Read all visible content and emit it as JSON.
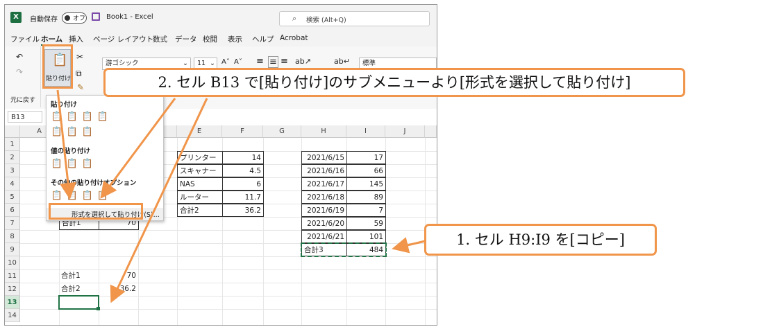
{
  "titlebar": {
    "autosave_label": "自動保存",
    "autosave_state": "オフ",
    "workbook_title": "Book1  -  Excel",
    "search_placeholder": "検索 (Alt+Q)"
  },
  "menu": [
    "ファイル",
    "ホーム",
    "挿入",
    "ページ レイアウト",
    "数式",
    "データ",
    "校閲",
    "表示",
    "ヘルプ",
    "Acrobat"
  ],
  "ribbon": {
    "paste_label": "貼り付け",
    "undo_label": "元に戻す",
    "font_name": "游ゴシック",
    "font_size": "11",
    "number_format": "標準"
  },
  "namebox": "B13",
  "columns": [
    "A",
    "B",
    "C",
    "D",
    "E",
    "F",
    "G",
    "H",
    "I",
    "J"
  ],
  "rows": [
    "1",
    "2",
    "3",
    "4",
    "5",
    "6",
    "7",
    "8",
    "9",
    "10",
    "11",
    "12",
    "13",
    "14"
  ],
  "cells": {
    "e2": "プリンター",
    "f2": "14",
    "e3": "スキャナー",
    "f3": "4.5",
    "e4": "NAS",
    "f4": "6",
    "e5": "ルーター",
    "f5": "11.7",
    "e6": "合計2",
    "f6": "36.2",
    "h2": "2021/6/15",
    "i2": "17",
    "h3": "2021/6/16",
    "i3": "66",
    "h4": "2021/6/17",
    "i4": "145",
    "h5": "2021/6/18",
    "i5": "89",
    "h6": "2021/6/19",
    "i6": "7",
    "h7": "2021/6/20",
    "i7": "59",
    "h8": "2021/6/21",
    "i8": "101",
    "h9": "合計3",
    "i9": "484",
    "b7": "合計1",
    "c7": "70",
    "b11": "合計1",
    "c11": "70",
    "b12": "合計2",
    "c12": "36.2"
  },
  "paste_menu": {
    "section_paste": "貼り付け",
    "section_values": "値の貼り付け",
    "section_other": "その他の貼り付けオプション",
    "paste_special": "形式を選択して貼り付け(S)..."
  },
  "callouts": {
    "step2": "2.  セル B13 で[貼り付け]のサブメニューより[形式を選択して貼り付け]",
    "step1": "1.  セル H9:I9 を[コピー]"
  },
  "colors": {
    "accent_orange": "#f0954a",
    "excel_green": "#1d6f42",
    "selection_green": "#217346"
  }
}
